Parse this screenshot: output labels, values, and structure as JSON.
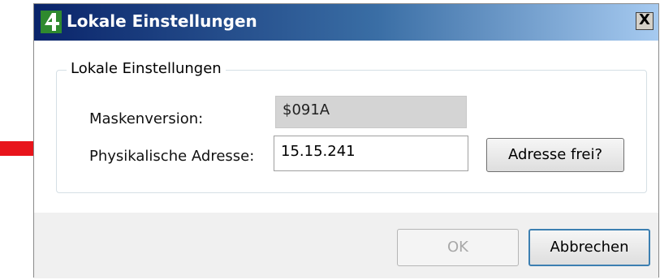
{
  "window": {
    "title": "Lokale Einstellungen",
    "close_glyph": "X",
    "icon": "app-4-icon"
  },
  "group": {
    "legend": "Lokale Einstellungen"
  },
  "fields": {
    "mask_version": {
      "label": "Maskenversion:",
      "value": "$091A"
    },
    "physical_address": {
      "label": "Physikalische Adresse:",
      "value": "15.15.241"
    }
  },
  "buttons": {
    "check_address": "Adresse frei?",
    "ok": "OK",
    "cancel": "Abbrechen"
  },
  "annotation": {
    "icon": "red-arrow-icon",
    "color": "#e8141b"
  },
  "colors": {
    "title_start": "#0a246a",
    "title_end": "#a6caf0",
    "default_button_border": "#3c7fb1"
  }
}
